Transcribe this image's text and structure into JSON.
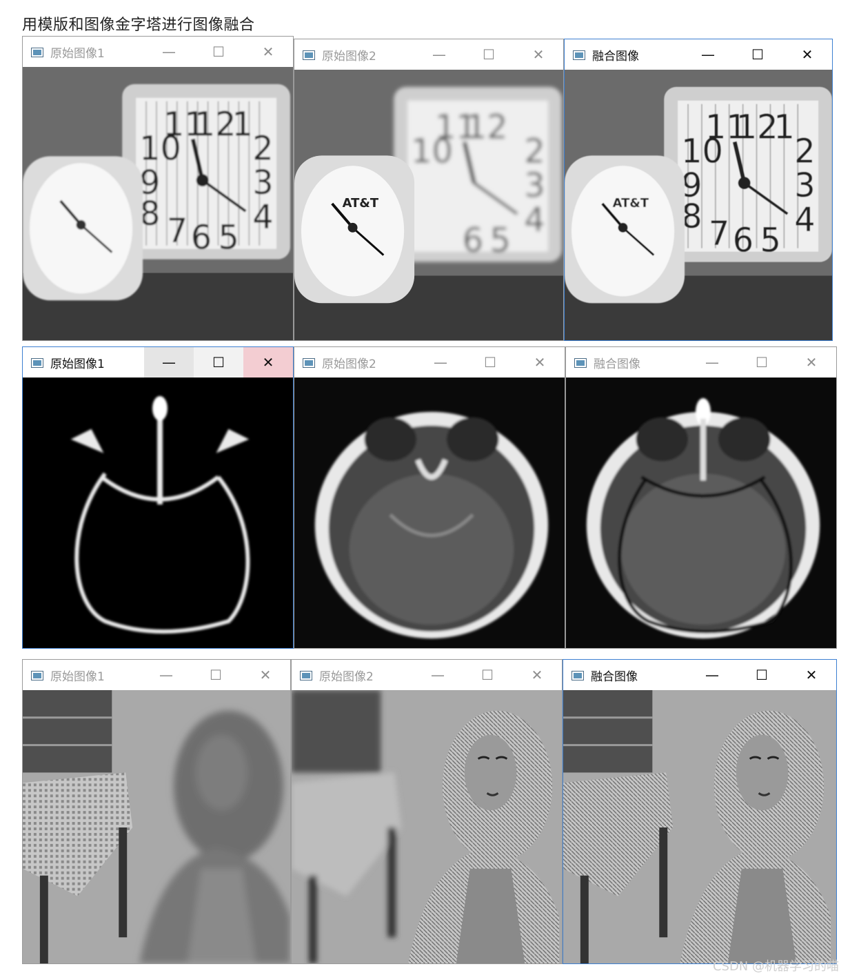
{
  "heading": "用模版和图像金字塔进行图像融合",
  "rows": [
    {
      "windows": [
        {
          "title": "原始图像1",
          "controls": {
            "min": "—",
            "max": "☐",
            "close": "✕"
          }
        },
        {
          "title": "原始图像2",
          "controls": {
            "min": "—",
            "max": "☐",
            "close": "✕"
          }
        },
        {
          "title": "融合图像",
          "controls": {
            "min": "—",
            "max": "☐",
            "close": "✕"
          }
        }
      ]
    },
    {
      "windows": [
        {
          "title": "原始图像1",
          "controls": {
            "min": "—",
            "max": "☐",
            "close": "✕"
          }
        },
        {
          "title": "原始图像2",
          "controls": {
            "min": "—",
            "max": "☐",
            "close": "✕"
          }
        },
        {
          "title": "融合图像",
          "controls": {
            "min": "—",
            "max": "☐",
            "close": "✕"
          }
        }
      ]
    },
    {
      "windows": [
        {
          "title": "原始图像1",
          "controls": {
            "min": "—",
            "max": "☐",
            "close": "✕"
          }
        },
        {
          "title": "原始图像2",
          "controls": {
            "min": "—",
            "max": "☐",
            "close": "✕"
          }
        },
        {
          "title": "融合图像",
          "controls": {
            "min": "—",
            "max": "☐",
            "close": "✕"
          }
        }
      ]
    }
  ],
  "watermark": "CSDN @机器学习的喵",
  "clock_digits": {
    "left_face": [
      "10",
      "11",
      "12",
      "1",
      "2",
      "3",
      "4",
      "5",
      "6",
      "7",
      "8",
      "9"
    ]
  },
  "icons": [
    "app-window-icon",
    "minimize-icon",
    "maximize-icon",
    "close-icon"
  ],
  "colors": {
    "active_border": "#3c7fd1",
    "close_hover": "#f3cdd2"
  }
}
